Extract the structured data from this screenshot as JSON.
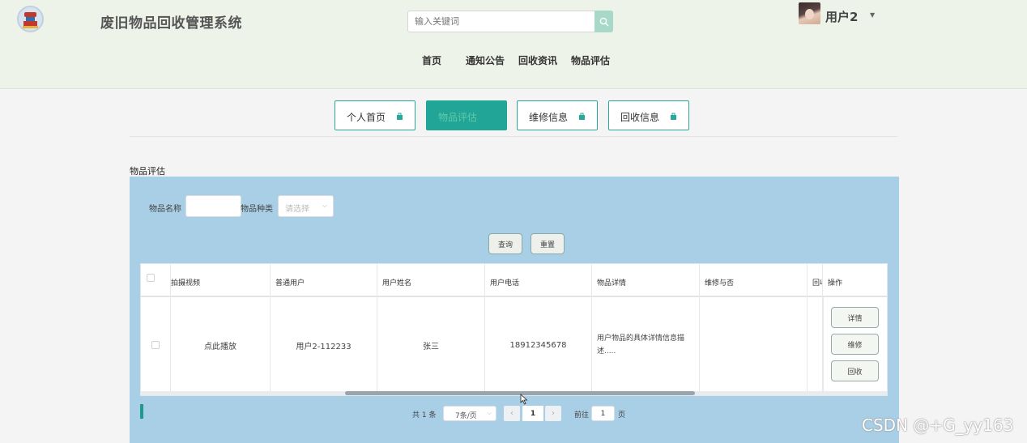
{
  "header": {
    "site_title": "废旧物品回收管理系统",
    "search_placeholder": "输入关键词",
    "user_name": "用户2",
    "nav": [
      "首页",
      "通知公告",
      "回收资讯",
      "物品评估"
    ]
  },
  "tabs": [
    {
      "label": "个人首页",
      "active": false
    },
    {
      "label": "物品评估",
      "active": true
    },
    {
      "label": "维修信息",
      "active": false
    },
    {
      "label": "回收信息",
      "active": false
    }
  ],
  "section_title": "物品评估",
  "filters": {
    "name_label": "物品名称",
    "type_label": "物品种类",
    "type_placeholder": "请选择",
    "query_label": "查询",
    "reset_label": "重置"
  },
  "table": {
    "headers": [
      "拍摄视频",
      "普通用户",
      "用户姓名",
      "用户电话",
      "物品详情",
      "维修与否",
      "回收",
      "操作"
    ],
    "rows": [
      {
        "video": "点此播放",
        "user": "用户2-112233",
        "name": "张三",
        "phone": "18912345678",
        "detail": "用户物品的具体详情信息描述.....",
        "repair": "",
        "recycle": "",
        "actions": [
          "详情",
          "维修",
          "回收"
        ]
      }
    ]
  },
  "pagination": {
    "total": "共 1 条",
    "page_size": "7条/页",
    "current_page": "1",
    "goto_label": "前往",
    "goto_value": "1",
    "page_unit": "页"
  },
  "watermark": "CSDN @+G_yy163",
  "colors": {
    "accent": "#20a596",
    "panel": "#a8cfe6",
    "header_bg": "#eef3ea"
  }
}
